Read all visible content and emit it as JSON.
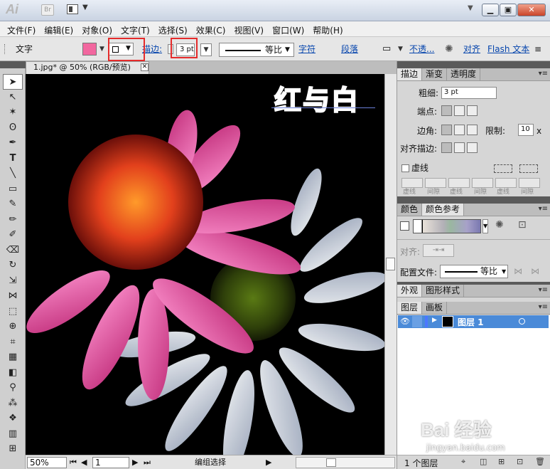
{
  "app": {
    "logo": "Ai",
    "bridge_label": "Br"
  },
  "menubar": [
    "文件(F)",
    "编辑(E)",
    "对象(O)",
    "文字(T)",
    "选择(S)",
    "效果(C)",
    "视图(V)",
    "窗口(W)",
    "帮助(H)"
  ],
  "control_bar": {
    "mode_label": "文字",
    "fill_color": "#f2679f",
    "stroke_label": "描边:",
    "stroke_weight": "3 pt",
    "stroke_profile": "等比",
    "char_link": "字符",
    "para_link": "段落",
    "opacity_link": "不透...",
    "align_link": "对齐",
    "flash_link": "Flash 文本"
  },
  "document": {
    "tab_title": "1.jpg* @ 50% (RGB/预览)",
    "text_overlay": "红与白",
    "text_color": "#ef5d9f"
  },
  "status_bar": {
    "zoom": "50%",
    "page": "1",
    "status": "编组选择"
  },
  "stroke_panel": {
    "tabs": [
      "描边",
      "渐变",
      "透明度"
    ],
    "weight_label": "粗细:",
    "weight_value": "3 pt",
    "cap_label": "端点:",
    "corner_label": "边角:",
    "limit_label": "限制:",
    "limit_value": "10",
    "limit_suffix": "x",
    "align_label": "对齐描边:",
    "dash_label": "虚线",
    "dash_sublabels": [
      "虚线",
      "间隙",
      "虚线",
      "间隙",
      "虚线",
      "间隙"
    ]
  },
  "color_panel": {
    "tabs": [
      "颜色",
      "颜色参考"
    ],
    "align_label": "对齐:",
    "profile_label": "配置文件:",
    "profile_value": "等比"
  },
  "appearance_panel": {
    "tabs": [
      "外观",
      "图形样式"
    ]
  },
  "layers_panel": {
    "tabs": [
      "图层",
      "画板"
    ],
    "layer_name": "图层 1",
    "footer": "1 个图层"
  },
  "watermark": {
    "brand": "Bai 经验",
    "url": "jingyan.baidu.com"
  }
}
